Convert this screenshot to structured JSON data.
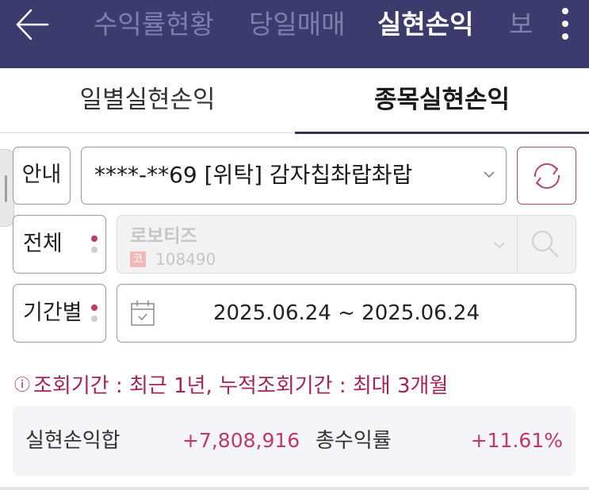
{
  "top_nav": {
    "tabs": [
      "수익률현황",
      "당일매매",
      "실현손익",
      "보"
    ],
    "active_tab": "실현손익",
    "back_icon": "arrow-left-icon",
    "more_icon": "more-vertical-icon",
    "background": "#3b3b6d"
  },
  "sub_tabs": {
    "items": [
      "일별실현손익",
      "종목실현손익"
    ],
    "active": "종목실현손익"
  },
  "account_row": {
    "info_label": "안내",
    "account_value": "****-**69 [위탁] 감자칩촤랍촤랍",
    "dropdown_icon": "chevron-down-icon",
    "refresh_icon": "refresh-icon"
  },
  "stock_row": {
    "filter_label": "전체",
    "stock_name": "로보티즈",
    "market_badge": "코",
    "stock_code": "108490",
    "dropdown_icon": "chevron-down-icon",
    "search_icon": "search-icon"
  },
  "period_row": {
    "filter_label": "기간별",
    "calendar_icon": "calendar-icon",
    "date_range": "2025.06.24 ~ 2025.06.24"
  },
  "notice": {
    "icon": "info-circle-icon",
    "mark": "ⓘ",
    "text": "조회기간 : 최근 1년, 누적조회기간 : 최대 3개월"
  },
  "summary": {
    "realized_pl_label": "실현손익합",
    "realized_pl_value": "+7,808,916",
    "total_return_label": "총수익률",
    "total_return_value": "+11.61%"
  },
  "colors": {
    "accent": "#c0386c",
    "header": "#3b3b6d",
    "badge": "#d9534f"
  }
}
